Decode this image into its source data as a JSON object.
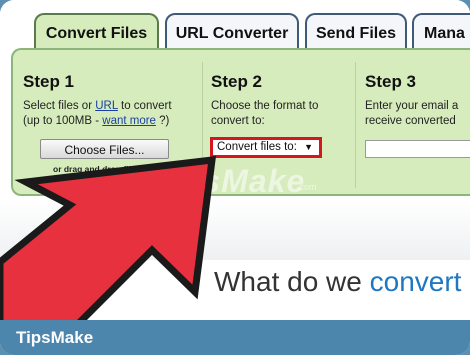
{
  "tabs": [
    {
      "label": "Convert Files"
    },
    {
      "label": "URL Converter"
    },
    {
      "label": "Send Files"
    },
    {
      "label": "Mana"
    }
  ],
  "step1": {
    "heading": "Step 1",
    "text_prefix": "Select files or ",
    "url_link": "URL",
    "text_after_url": " to convert",
    "line2_prefix": "(up to 100MB - ",
    "want_more_link": "want more",
    "line2_suffix": " ?)",
    "choose_button": "Choose Files...",
    "drag_note": "or drag and drop files"
  },
  "step2": {
    "heading": "Step 2",
    "text": "Choose the format to convert to:",
    "select_value": "Convert files to:",
    "select_arrow": "▼"
  },
  "step3": {
    "heading": "Step 3",
    "text": "Enter your email a receive converted"
  },
  "headline": {
    "prefix": "What do we ",
    "accent": "convert"
  },
  "watermark": {
    "text": "TipsMake",
    "small": ".com"
  },
  "footer": {
    "logo": "TipsMake"
  },
  "colors": {
    "panel": "#d6ecbc",
    "arrow": "#e8313e",
    "highlight_box": "#d4171e",
    "footer": "#4d86ad",
    "accent_text": "#1f77c2"
  }
}
